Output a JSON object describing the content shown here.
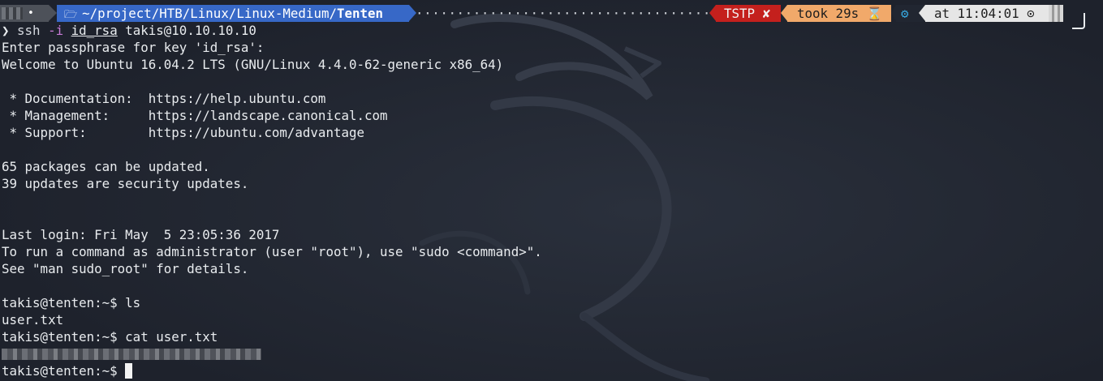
{
  "prompt_bar": {
    "os_icon": "apple-logo-icon",
    "folder_icon": "folder-icon",
    "path_prefix": "~/project/HTB/Linux/Linux-Medium/",
    "path_current": "Tenten",
    "status_label": "TSTP",
    "status_icon": "cross-mark-icon",
    "took_label": "took 29s",
    "hourglass_icon": "hourglass-icon",
    "gear_icon": "gear-icon",
    "time_label": "at 11:04:01",
    "clock_icon": "clock-icon",
    "colors": {
      "path_bg": "#3768c7",
      "status_bg": "#c4201d",
      "took_bg": "#f1a96a",
      "time_bg": "#e6e6e6",
      "terminal_bg": "#212631",
      "text": "#e9ecef"
    }
  },
  "terminal": {
    "ssh": {
      "prompt_symbol": "❯",
      "command": "ssh",
      "flag": "-i",
      "key_file": "id_rsa",
      "target": "takis@10.10.10.10"
    },
    "output": {
      "passphrase": "Enter passphrase for key 'id_rsa':",
      "welcome": "Welcome to Ubuntu 16.04.2 LTS (GNU/Linux 4.4.0-62-generic x86_64)",
      "documentation": " * Documentation:  https://help.ubuntu.com",
      "management": " * Management:     https://landscape.canonical.com",
      "support": " * Support:        https://ubuntu.com/advantage",
      "packages": "65 packages can be updated.",
      "security": "39 updates are security updates.",
      "last_login": "Last login: Fri May  5 23:05:36 2017",
      "sudo_hint": "To run a command as administrator (user \"root\"), use \"sudo <command>\".",
      "sudo_root": "See \"man sudo_root\" for details."
    },
    "commands": {
      "ls_prompt": "takis@tenten:~$ ls",
      "ls_output": "user.txt",
      "cat_prompt": "takis@tenten:~$ cat user.txt",
      "final_prompt": "takis@tenten:~$ "
    }
  }
}
